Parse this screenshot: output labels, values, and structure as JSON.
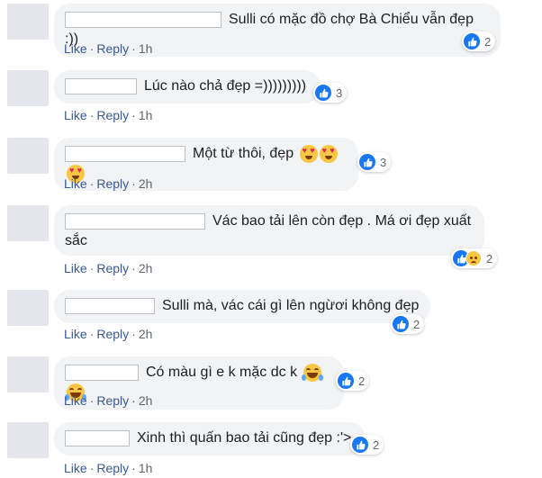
{
  "comments": [
    {
      "text": "Sulli có mặc đồ chợ Bà Chiểu vẫn đẹp :))",
      "emoji": [],
      "reactions": "2",
      "sad": false,
      "like": "Like",
      "reply": "Reply",
      "time": "1h"
    },
    {
      "text": "Lúc nào chả đẹp =)))))))))",
      "emoji": [],
      "reactions": "3",
      "sad": false,
      "like": "Like",
      "reply": "Reply",
      "time": "1h"
    },
    {
      "text": "Một từ thôi, đẹp",
      "emoji": [
        "heart-eyes-emoji",
        "heart-eyes-emoji",
        "heart-eyes-emoji"
      ],
      "reactions": "3",
      "sad": false,
      "like": "Like",
      "reply": "Reply",
      "time": "2h"
    },
    {
      "text": "Vác bao tải lên còn đẹp . Má ơi đẹp xuất",
      "text2": "sắc",
      "emoji": [],
      "reactions": "2",
      "sad": true,
      "like": "Like",
      "reply": "Reply",
      "time": "2h"
    },
    {
      "text": "Sulli mà, vác cái gì lên ngừơi không đẹp",
      "emoji": [],
      "reactions": "2",
      "sad": false,
      "like": "Like",
      "reply": "Reply",
      "time": "2h"
    },
    {
      "text": "Có màu gì e k mặc dc k",
      "emoji": [
        "laughing-emoji",
        "laughing-emoji"
      ],
      "reactions": "2",
      "sad": false,
      "like": "Like",
      "reply": "Reply",
      "time": "2h"
    },
    {
      "text": "Xinh thì quấn bao tải cũng đẹp :'>",
      "emoji": [],
      "reactions": "2",
      "sad": false,
      "like": "Like",
      "reply": "Reply",
      "time": "1h"
    }
  ],
  "colors": {
    "link": "#385898",
    "bubble": "#f2f3f5",
    "like_blue": "#1877f2",
    "meta": "#606770"
  },
  "icons": {
    "like": "thumbs-up-icon",
    "sad": "sad-face-icon"
  }
}
